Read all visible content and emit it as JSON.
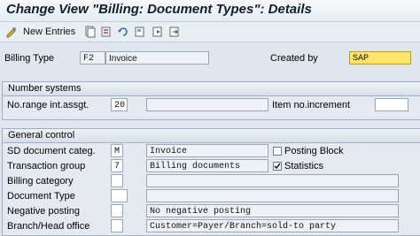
{
  "window": {
    "title": "Change View \"Billing: Document Types\": Details"
  },
  "toolbar": {
    "new_entries_label": "New Entries",
    "icons": [
      "edit-glasses-icon",
      "copy-icon",
      "delete-icon",
      "undo-icon",
      "copy-as-icon",
      "next-entry-icon",
      "export-icon"
    ]
  },
  "header": {
    "billing_type_label": "Billing Type",
    "billing_type_code": "F2",
    "billing_type_desc": "Invoice",
    "created_by_label": "Created by",
    "created_by_value": "SAP"
  },
  "number_systems": {
    "title": "Number systems",
    "range_label": "No.range int.assgt.",
    "range_value": "20",
    "increment_label": "Item no.increment",
    "increment_value": ""
  },
  "general_control": {
    "title": "General control",
    "sd_doc_categ_label": "SD document categ.",
    "sd_doc_categ_code": "M",
    "sd_doc_categ_desc": "Invoice",
    "posting_block_label": "Posting Block",
    "posting_block_checked": false,
    "transaction_group_label": "Transaction group",
    "transaction_group_code": "7",
    "transaction_group_desc": "Billing documents",
    "statistics_label": "Statistics",
    "statistics_checked": true,
    "billing_category_label": "Billing category",
    "billing_category_value": "",
    "document_type_label": "Document Type",
    "document_type_value": "",
    "negative_posting_label": "Negative posting",
    "negative_posting_code": "",
    "negative_posting_desc": "No negative posting",
    "branch_label": "Branch/Head office",
    "branch_desc": "Customer=Payer/Branch=sold-to party"
  }
}
